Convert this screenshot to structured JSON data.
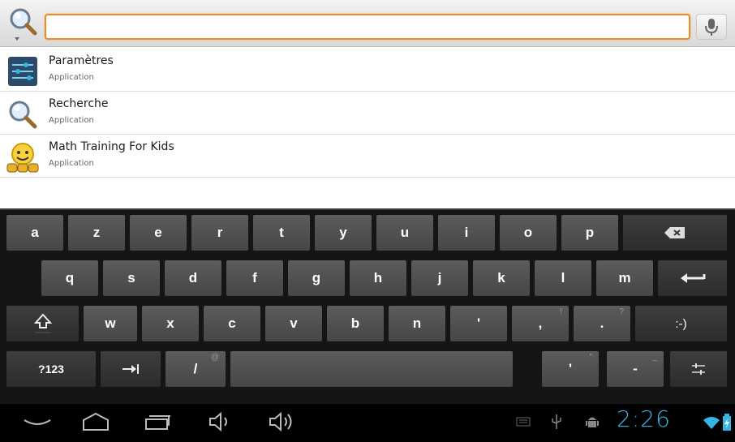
{
  "search": {
    "value": "",
    "placeholder": ""
  },
  "results": [
    {
      "title": "Paramètres",
      "subtitle": "Application",
      "icon": "settings-app-icon"
    },
    {
      "title": "Recherche",
      "subtitle": "Application",
      "icon": "search-app-icon"
    },
    {
      "title": "Math Training For Kids",
      "subtitle": "Application",
      "icon": "math-kids-app-icon"
    }
  ],
  "keyboard": {
    "row1": [
      "a",
      "z",
      "e",
      "r",
      "t",
      "y",
      "u",
      "i",
      "o",
      "p"
    ],
    "row2": [
      "q",
      "s",
      "d",
      "f",
      "g",
      "h",
      "j",
      "k",
      "l",
      "m"
    ],
    "row3": [
      "w",
      "x",
      "c",
      "v",
      "b",
      "n"
    ],
    "apostrophe": "'",
    "comma": ",",
    "comma_hint": "!",
    "period": ".",
    "period_hint": "?",
    "smiley": ":-)",
    "symbols": "?123",
    "slash": "/",
    "slash_hint": "@",
    "apostrophe2": "'",
    "apostrophe2_hint": "\"",
    "dash": "-",
    "dash_hint": "_"
  },
  "status": {
    "time": "2:26"
  },
  "colors": {
    "accent": "#33b5e5",
    "search_focus": "#e88c2a",
    "keyboard_bg": "#151515"
  }
}
